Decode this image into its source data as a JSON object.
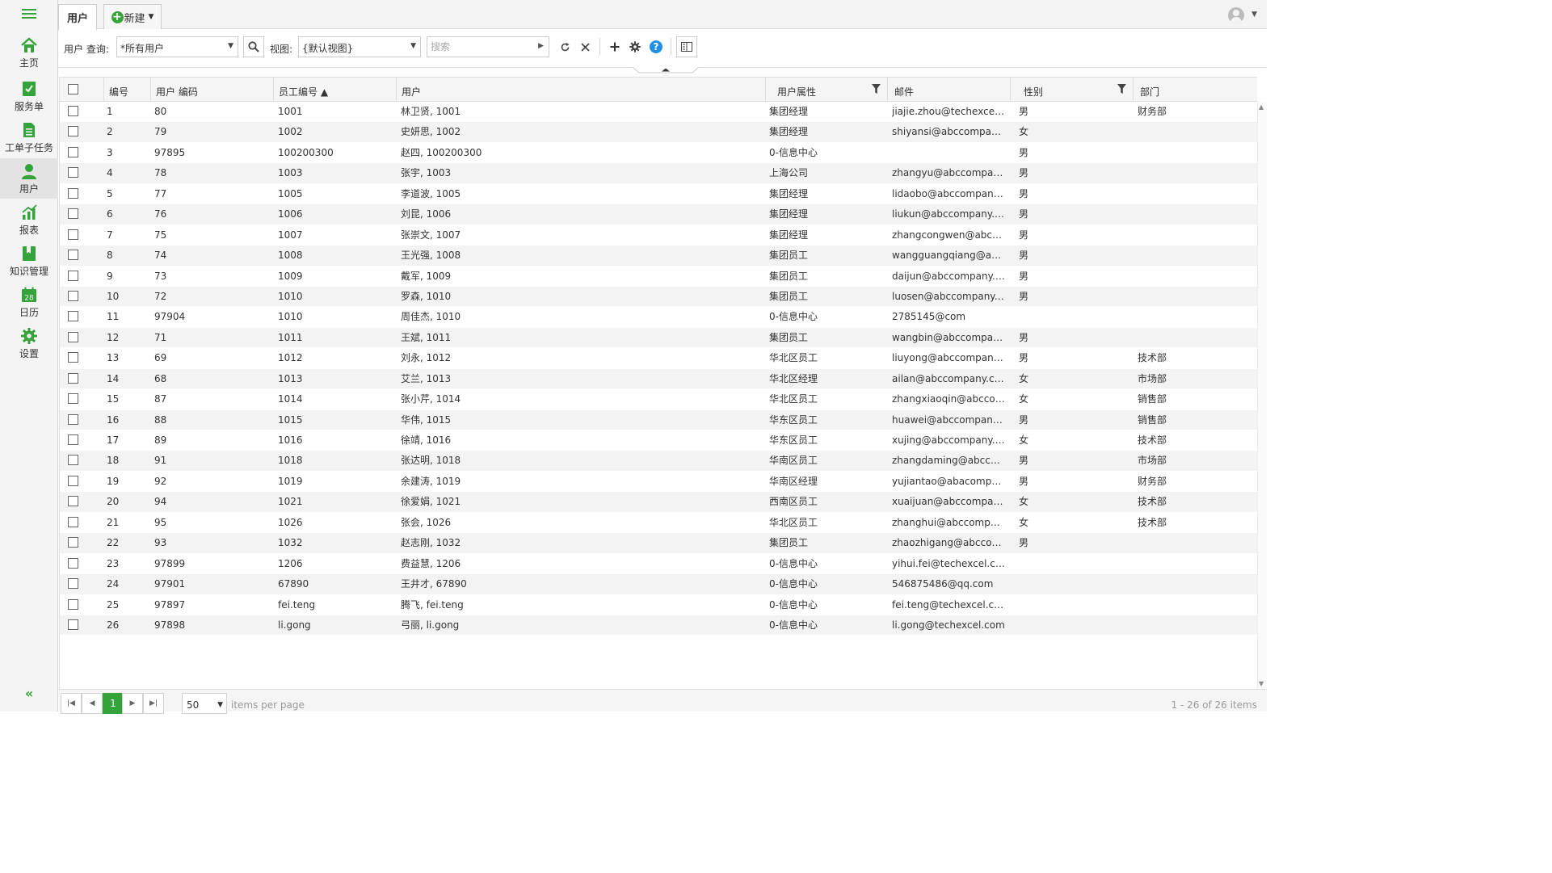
{
  "sidebar": {
    "items": [
      {
        "label": "主页",
        "icon": "home-icon"
      },
      {
        "label": "服务单",
        "icon": "service-order-icon"
      },
      {
        "label": "工单子任务",
        "icon": "subtask-icon"
      },
      {
        "label": "用户",
        "icon": "user-icon",
        "active": true
      },
      {
        "label": "报表",
        "icon": "report-icon"
      },
      {
        "label": "知识管理",
        "icon": "knowledge-icon"
      },
      {
        "label": "日历",
        "icon": "calendar-icon",
        "day": "28"
      },
      {
        "label": "设置",
        "icon": "settings-icon"
      }
    ],
    "collapse_glyph": "«"
  },
  "tabs": {
    "active": "用户",
    "new_label": "新建"
  },
  "toolbar": {
    "query_label": "用户 查询:",
    "query_value": "*所有用户",
    "view_label": "视图:",
    "view_value": "{默认视图}",
    "search_placeholder": "搜索"
  },
  "colors": {
    "accent": "#33a33a",
    "help": "#1e90e6"
  },
  "grid": {
    "columns": [
      "编号",
      "用户 编码",
      "员工编号 ▲",
      "用户",
      "用户属性",
      "邮件",
      "性别",
      "部门"
    ],
    "rows": [
      [
        "1",
        "80",
        "1001",
        "林卫贤, 1001",
        "集团经理",
        "jiajie.zhou@techexcel.c...",
        "男",
        "财务部"
      ],
      [
        "2",
        "79",
        "1002",
        "史妍思, 1002",
        "集团经理",
        "shiyansi@abccompany....",
        "女",
        ""
      ],
      [
        "3",
        "97895",
        "100200300",
        "赵四, 100200300",
        "0-信息中心",
        "",
        "男",
        ""
      ],
      [
        "4",
        "78",
        "1003",
        "张宇, 1003",
        "上海公司",
        "zhangyu@abccompany....",
        "男",
        ""
      ],
      [
        "5",
        "77",
        "1005",
        "李道波, 1005",
        "集团经理",
        "lidaobo@abccompany.c...",
        "男",
        ""
      ],
      [
        "6",
        "76",
        "1006",
        "刘昆, 1006",
        "集团经理",
        "liukun@abccompany.com",
        "男",
        ""
      ],
      [
        "7",
        "75",
        "1007",
        "张崇文, 1007",
        "集团经理",
        "zhangcongwen@abcco...",
        "男",
        ""
      ],
      [
        "8",
        "74",
        "1008",
        "王光强, 1008",
        "集团员工",
        "wangguangqiang@abc...",
        "男",
        ""
      ],
      [
        "9",
        "73",
        "1009",
        "戴军, 1009",
        "集团员工",
        "daijun@abccompany.com",
        "男",
        ""
      ],
      [
        "10",
        "72",
        "1010",
        "罗森, 1010",
        "集团员工",
        "luosen@abccompany.c...",
        "男",
        ""
      ],
      [
        "11",
        "97904",
        "1010",
        "周佳杰, 1010",
        "0-信息中心",
        "2785145@com",
        "",
        ""
      ],
      [
        "12",
        "71",
        "1011",
        "王斌, 1011",
        "集团员工",
        "wangbin@abccompany....",
        "男",
        ""
      ],
      [
        "13",
        "69",
        "1012",
        "刘永, 1012",
        "华北区员工",
        "liuyong@abccompany.c...",
        "男",
        "技术部"
      ],
      [
        "14",
        "68",
        "1013",
        "艾兰, 1013",
        "华北区经理",
        "ailan@abccompany.com",
        "女",
        "市场部"
      ],
      [
        "15",
        "87",
        "1014",
        "张小芹, 1014",
        "华北区员工",
        "zhangxiaoqin@abccom...",
        "女",
        "销售部"
      ],
      [
        "16",
        "88",
        "1015",
        "华伟, 1015",
        "华东区员工",
        "huawei@abccompany.c...",
        "男",
        "销售部"
      ],
      [
        "17",
        "89",
        "1016",
        "徐靖, 1016",
        "华东区员工",
        "xujing@abccompany.com",
        "女",
        "技术部"
      ],
      [
        "18",
        "91",
        "1018",
        "张达明, 1018",
        "华南区员工",
        "zhangdaming@abccom...",
        "男",
        "市场部"
      ],
      [
        "19",
        "92",
        "1019",
        "余建涛, 1019",
        "华南区经理",
        "yujiantao@abacompa...",
        "男",
        "财务部"
      ],
      [
        "20",
        "94",
        "1021",
        "徐爱娟, 1021",
        "西南区员工",
        "xuaijuan@abccompany....",
        "女",
        "技术部"
      ],
      [
        "21",
        "95",
        "1026",
        "张会, 1026",
        "华北区员工",
        "zhanghui@abccompan...",
        "女",
        "技术部"
      ],
      [
        "22",
        "93",
        "1032",
        "赵志刚, 1032",
        "集团员工",
        "zhaozhigang@abccom...",
        "男",
        ""
      ],
      [
        "23",
        "97899",
        "1206",
        "费益慧, 1206",
        "0-信息中心",
        "yihui.fei@techexcel.com",
        "",
        ""
      ],
      [
        "24",
        "97901",
        "67890",
        "王井才, 67890",
        "0-信息中心",
        "546875486@qq.com",
        "",
        ""
      ],
      [
        "25",
        "97897",
        "fei.teng",
        "腾飞, fei.teng",
        "0-信息中心",
        "fei.teng@techexcel.com",
        "",
        ""
      ],
      [
        "26",
        "97898",
        "li.gong",
        "弓丽, li.gong",
        "0-信息中心",
        "li.gong@techexcel.com",
        "",
        ""
      ]
    ]
  },
  "pager": {
    "current_page": "1",
    "page_size": "50",
    "per_page_label": "items per page",
    "summary": "1 - 26 of 26 items"
  }
}
